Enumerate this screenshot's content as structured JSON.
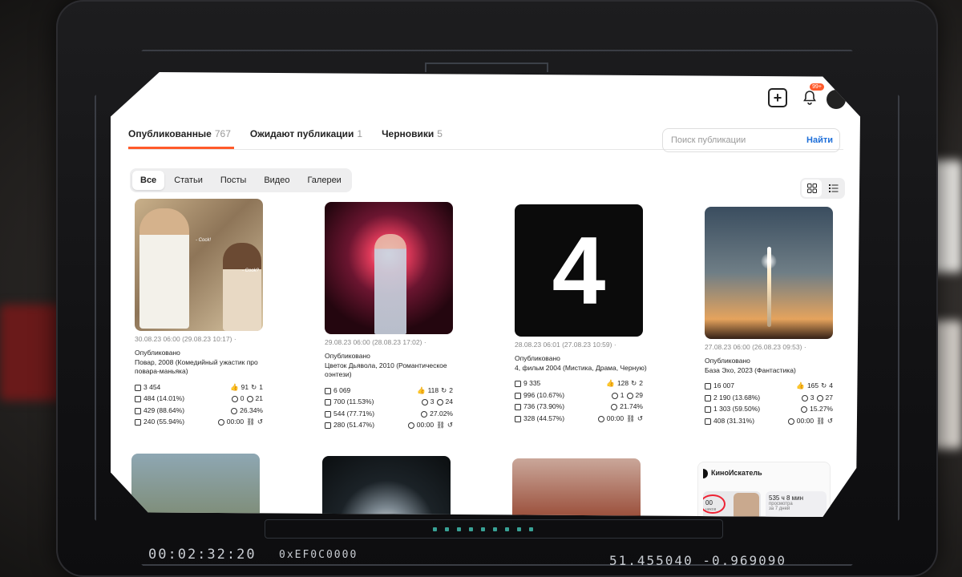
{
  "header": {
    "notification_badge": "99+"
  },
  "tabs": [
    {
      "label": "Опубликованные",
      "count": "767",
      "active": true
    },
    {
      "label": "Ожидают публикации",
      "count": "1",
      "active": false
    },
    {
      "label": "Черновики",
      "count": "5",
      "active": false
    }
  ],
  "search": {
    "placeholder": "Поиск публикации",
    "button": "Найти"
  },
  "filters": [
    {
      "label": "Все",
      "active": true
    },
    {
      "label": "Статьи",
      "active": false
    },
    {
      "label": "Посты",
      "active": false
    },
    {
      "label": "Видео",
      "active": false
    },
    {
      "label": "Галереи",
      "active": false
    }
  ],
  "cards": [
    {
      "date": "30.08.23 06:00 (29.08.23 10:17) ·",
      "status": "Опубликовано",
      "title": "Повар, 2008 (Комедийный ужастик про повара-маньяка)",
      "stats": {
        "views": "3 454",
        "likes": "91",
        "reposts": "1",
        "reads": "484 (14.01%)",
        "subs": "0",
        "comments": "21",
        "full": "429 (88.64%)",
        "ctr": "26.34%",
        "dorch": "240 (55.94%)",
        "time": "00:00"
      },
      "bubbles": [
        "- Cock!",
        "- Cook?"
      ]
    },
    {
      "date": "29.08.23 06:00 (28.08.23 17:02) ·",
      "status": "Опубликовано",
      "title": "Цветок Дьявола, 2010 (Романтическое оэнтези)",
      "stats": {
        "views": "6 069",
        "likes": "118",
        "reposts": "2",
        "reads": "700 (11.53%)",
        "subs": "3",
        "comments": "24",
        "full": "544 (77.71%)",
        "ctr": "27.02%",
        "dorch": "280 (51.47%)",
        "time": "00:00"
      }
    },
    {
      "date": "28.08.23 06:01 (27.08.23 10:59) ·",
      "status": "Опубликовано",
      "title": "4, фильм 2004 (Мистика, Драма, Черную)",
      "thumb_text": "4",
      "stats": {
        "views": "9 335",
        "likes": "128",
        "reposts": "2",
        "reads": "996 (10.67%)",
        "subs": "1",
        "comments": "29",
        "full": "736 (73.90%)",
        "ctr": "21.74%",
        "dorch": "328 (44.57%)",
        "time": "00:00"
      }
    },
    {
      "date": "27.08.23 06:00 (26.08.23 09:53) ·",
      "status": "Опубликовано",
      "title": "База Эхо, 2023 (Фантастика)",
      "stats": {
        "views": "16 007",
        "likes": "165",
        "reposts": "4",
        "reads": "2 190 (13.68%)",
        "subs": "3",
        "comments": "27",
        "full": "1 303 (59.50%)",
        "ctr": "15.27%",
        "dorch": "408 (31.31%)",
        "time": "00:00"
      }
    }
  ],
  "channel": {
    "name": "КиноИскатель",
    "big": "535 ч 8 мин",
    "sub1": "просмотра",
    "sub2": "за 7 дней",
    "left_big": "00",
    "left_sub": "ников"
  },
  "hud": {
    "time": "00:02:32:20",
    "hex": "0xEF0C0000",
    "coords": "51.455040 -0.969090"
  },
  "colors": {
    "accent": "#ff5a2a",
    "link": "#1e6fd9"
  }
}
